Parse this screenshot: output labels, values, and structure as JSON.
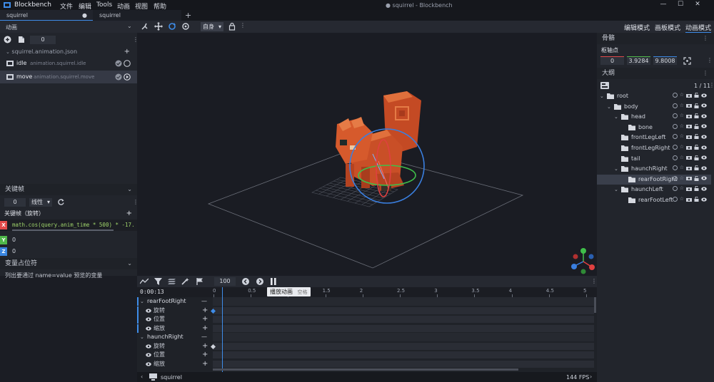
{
  "menubar": {
    "app_name": "Blockbench",
    "menus": [
      "文件",
      "编辑",
      "Tools",
      "动画",
      "视图",
      "帮助"
    ],
    "window_title": "● squirrel - Blockbench"
  },
  "tabs": [
    {
      "label": "squirrel",
      "modified_dot": "●"
    },
    {
      "label": "squirrel"
    }
  ],
  "toolbar": {
    "space_select": "自身",
    "modes": [
      "编辑模式",
      "画板模式",
      "动画模式"
    ]
  },
  "animations_panel": {
    "title": "动画",
    "counter": "0",
    "file": "squirrel.animation.json",
    "items": [
      {
        "name": "idle",
        "path": "animation.squirrel.idle"
      },
      {
        "name": "move",
        "path": "animation.squirrel.move"
      }
    ]
  },
  "keyframe_panel": {
    "title": "关键帧",
    "time_value": "0",
    "interpolation": "线性",
    "section_label": "关键帧（旋转）",
    "axes": [
      {
        "letter": "X",
        "value": "math.cos(query.anim_time * 500) * -17.",
        "color": "#e24a4a"
      },
      {
        "letter": "Y",
        "value": "0",
        "color": "#4fb84a"
      },
      {
        "letter": "Z",
        "value": "0",
        "color": "#3a86e0"
      }
    ]
  },
  "variables_panel": {
    "title": "变量占位符",
    "text": "列出要通过 name=value 预览的变量"
  },
  "bones_panel": {
    "title": "骨骼",
    "pivot_label": "枢轴点",
    "pivot": [
      "0",
      "3.9284",
      "9.8008"
    ]
  },
  "outliner": {
    "title": "大纲",
    "count": "1 / 11",
    "items": [
      {
        "name": "root",
        "depth": 0,
        "expanded": true
      },
      {
        "name": "body",
        "depth": 1,
        "expanded": true
      },
      {
        "name": "head",
        "depth": 2,
        "expanded": true
      },
      {
        "name": "bone",
        "depth": 3,
        "expanded": false
      },
      {
        "name": "frontLegLeft",
        "depth": 2,
        "expanded": false
      },
      {
        "name": "frontLegRight",
        "depth": 2,
        "expanded": false
      },
      {
        "name": "tail",
        "depth": 2,
        "expanded": false
      },
      {
        "name": "haunchRight",
        "depth": 2,
        "expanded": true
      },
      {
        "name": "rearFootRight",
        "depth": 3,
        "expanded": false,
        "selected": true
      },
      {
        "name": "haunchLeft",
        "depth": 2,
        "expanded": true
      },
      {
        "name": "rearFootLeft",
        "depth": 3,
        "expanded": false
      }
    ]
  },
  "timeline": {
    "time": "0:00:13",
    "fps_input": "100",
    "ticks": [
      "0",
      "0.5",
      "1",
      "1.5",
      "2",
      "2.5",
      "3",
      "3.5",
      "4",
      "4.5",
      "5"
    ],
    "tooltip": "播放动画",
    "tooltip_key": "空格",
    "bones": [
      {
        "name": "rearFootRight",
        "channels": [
          "旋转",
          "位置",
          "缩放"
        ]
      },
      {
        "name": "haunchRight",
        "channels": [
          "旋转",
          "位置",
          "缩放"
        ]
      }
    ]
  },
  "statusbar": {
    "model": "squirrel",
    "fps": "144 FPS"
  },
  "colors": {
    "accent": "#3e8ce8",
    "model_orange": "#d65a2c",
    "gizmo_blue": "#3a7fe0",
    "gizmo_green": "#3fbf4a",
    "gizmo_red": "#e04040"
  }
}
